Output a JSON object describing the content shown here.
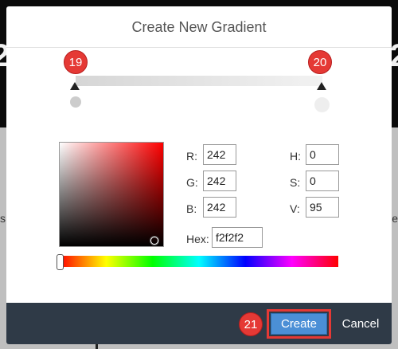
{
  "dialog": {
    "title": "Create New Gradient"
  },
  "markers": {
    "left_stop": "19",
    "right_stop": "20",
    "create": "21"
  },
  "gradient": {
    "left_stop_color": "#d6d6d6",
    "right_stop_color": "#f2f2f2"
  },
  "picker": {
    "selected_hue_color": "#ff0000",
    "r_label": "R:",
    "r_value": "242",
    "g_label": "G:",
    "g_value": "242",
    "b_label": "B:",
    "b_value": "242",
    "h_label": "H:",
    "h_value": "0",
    "s_label": "S:",
    "s_value": "0",
    "v_label": "V:",
    "v_value": "95",
    "hex_label": "Hex:",
    "hex_value": "f2f2f2"
  },
  "footer": {
    "create_label": "Create",
    "cancel_label": "Cancel"
  },
  "colors": {
    "footer_bg": "#2f3a47",
    "primary_button": "#4b8fd6",
    "marker_red": "#e53935"
  }
}
